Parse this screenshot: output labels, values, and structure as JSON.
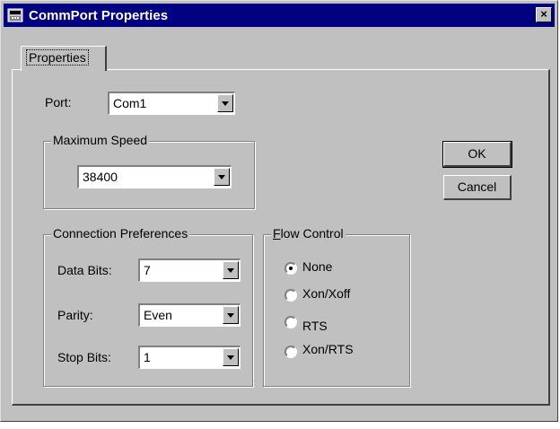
{
  "window": {
    "title": "CommPort Properties",
    "close_glyph": "×"
  },
  "tabs": [
    {
      "label": "Properties",
      "active": true
    }
  ],
  "port": {
    "label": "Port:",
    "value": "Com1"
  },
  "max_speed": {
    "legend": "Maximum Speed",
    "value": "38400"
  },
  "connection": {
    "legend": "Connection Preferences",
    "data_bits": {
      "label": "Data Bits:",
      "value": "7"
    },
    "parity": {
      "label": "Parity:",
      "value": "Even"
    },
    "stop_bits": {
      "label": "Stop Bits:",
      "value": "1"
    }
  },
  "flow_control": {
    "legend_accel": "F",
    "legend_rest": "low Control",
    "options": [
      {
        "label": "None",
        "selected": true
      },
      {
        "label": "Xon/Xoff",
        "selected": false
      },
      {
        "label": "RTS",
        "selected": false
      },
      {
        "label": "Xon/RTS",
        "selected": false
      }
    ]
  },
  "buttons": {
    "ok": "OK",
    "cancel": "Cancel"
  },
  "colors": {
    "titlebar": "#000080",
    "face": "#c0c0c0"
  },
  "icons": {
    "title_icon": "phone-icon",
    "close_icon": "close-icon",
    "dropdown_icon": "chevron-down-icon"
  }
}
